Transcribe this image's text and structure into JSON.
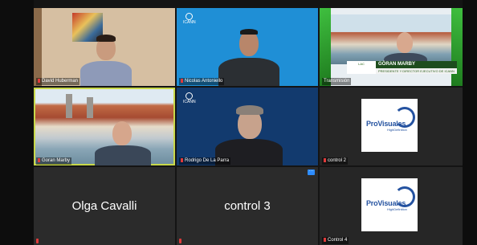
{
  "participants": [
    {
      "name": "David Huberman"
    },
    {
      "name": "Nicolas Antoniello",
      "logo_text": "ICANN"
    },
    {
      "name": "Transmisión",
      "banner": {
        "title": "GÖRAN MARBY",
        "subtitle": "PRESIDENTE Y DIRECTOR EJECUTIVO DE ICANN"
      }
    },
    {
      "name": "Goran Marby"
    },
    {
      "name": "Rodrigo De La Parra",
      "logo_text": "ICANN"
    },
    {
      "name": "control 2",
      "logo": {
        "brand": "ProVisuales",
        "sub": "HighDefinition"
      }
    },
    {
      "name": "Olga Cavalli"
    },
    {
      "name": "control 3"
    },
    {
      "name": "Control 4",
      "logo": {
        "brand": "ProVisuales",
        "sub": "HighDefinition"
      }
    }
  ],
  "more_button": "···",
  "colors": {
    "active_speaker_border": "#c8d84a",
    "mic_muted": "#e03b3b",
    "zoom_blue": "#2d8cff",
    "icann_blue": "#1f8fd6"
  }
}
